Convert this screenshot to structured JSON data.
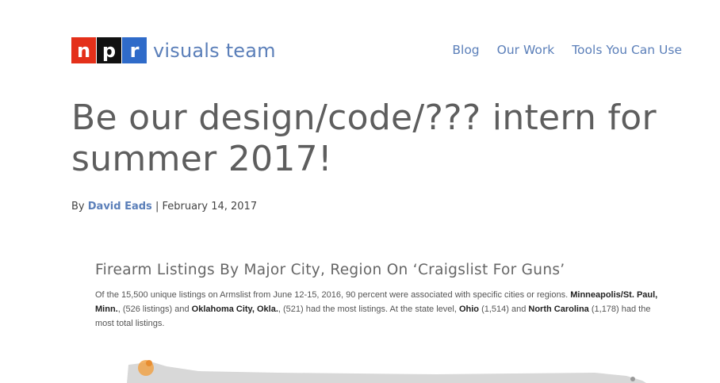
{
  "header": {
    "logo_letters": [
      "n",
      "p",
      "r"
    ],
    "logo_text": "visuals team",
    "nav": [
      "Blog",
      "Our Work",
      "Tools You Can Use"
    ]
  },
  "article": {
    "title": "Be our design/code/??? intern for summer 2017!",
    "byline_prefix": "By",
    "author": "David Eads",
    "separator": "|",
    "date": "February 14, 2017"
  },
  "graphic": {
    "title": "Firearm Listings By Major City, Region On ‘Craigslist For Guns’",
    "desc": {
      "t1": "Of the 15,500 unique listings on Armslist from June 12-15, 2016, 90 percent were associated with specific cities or regions. ",
      "b1": "Minneapolis/St. Paul, Minn.",
      "t2": ", (526 listings) and ",
      "b2": "Oklahoma City, Okla.",
      "t3": ", (521) had the most listings. At the state level, ",
      "b3": "Ohio",
      "t4": " (1,514) and ",
      "b4": "North Carolina",
      "t5": " (1,178) had the most total listings."
    }
  },
  "colors": {
    "npr_red": "#e4301a",
    "npr_black": "#111111",
    "npr_blue": "#2f6bc9",
    "link_blue": "#5b7fb9",
    "map_gray": "#d8d8d8",
    "marker_orange": "#f0a34a"
  }
}
